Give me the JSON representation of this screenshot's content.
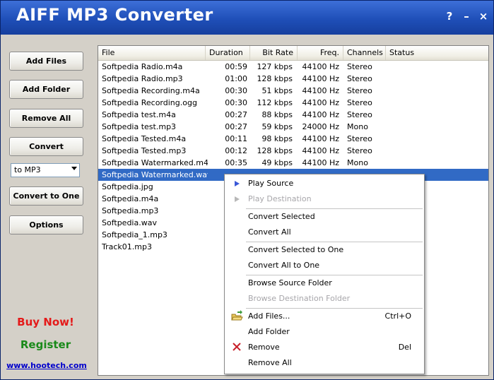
{
  "app": {
    "title": "AIFF MP3 Converter"
  },
  "titlebar": {
    "help_label": "?",
    "minimize_label": "–",
    "close_label": "×"
  },
  "sidebar": {
    "add_files": "Add Files",
    "add_folder": "Add Folder",
    "remove_all": "Remove All",
    "convert": "Convert",
    "format_selected": "to MP3",
    "convert_to_one": "Convert to One",
    "options": "Options",
    "buy_now": "Buy Now!",
    "register": "Register",
    "website": "www.hootech.com"
  },
  "colors": {
    "buy_now": "#e41a1a",
    "register": "#1a8a1a",
    "selection": "#316ac5",
    "titlebar": "#1f4fb8"
  },
  "table": {
    "columns": [
      "File",
      "Duration",
      "Bit Rate",
      "Freq.",
      "Channels",
      "Status"
    ],
    "rows": [
      [
        "Softpedia Radio.m4a",
        "00:59",
        "127 kbps",
        "44100 Hz",
        "Stereo"
      ],
      [
        "Softpedia Radio.mp3",
        "01:00",
        "128 kbps",
        "44100 Hz",
        "Stereo"
      ],
      [
        "Softpedia Recording.m4a",
        "00:30",
        "51 kbps",
        "44100 Hz",
        "Stereo"
      ],
      [
        "Softpedia Recording.ogg",
        "00:30",
        "112 kbps",
        "44100 Hz",
        "Stereo"
      ],
      [
        "Softpedia test.m4a",
        "00:27",
        "88 kbps",
        "44100 Hz",
        "Stereo"
      ],
      [
        "Softpedia test.mp3",
        "00:27",
        "59 kbps",
        "24000 Hz",
        "Mono"
      ],
      [
        "Softpedia Tested.m4a",
        "00:11",
        "98 kbps",
        "44100 Hz",
        "Stereo"
      ],
      [
        "Softpedia Tested.mp3",
        "00:12",
        "128 kbps",
        "44100 Hz",
        "Stereo"
      ],
      [
        "Softpedia Watermarked.m4a",
        "00:35",
        "49 kbps",
        "44100 Hz",
        "Mono"
      ],
      [
        "Softpedia Watermarked.wav",
        "",
        "",
        "",
        ""
      ],
      [
        "Softpedia.jpg",
        "",
        "",
        "",
        ""
      ],
      [
        "Softpedia.m4a",
        "",
        "",
        "",
        ""
      ],
      [
        "Softpedia.mp3",
        "",
        "",
        "",
        ""
      ],
      [
        "Softpedia.wav",
        "",
        "",
        "",
        ""
      ],
      [
        "Softpedia_1.mp3",
        "",
        "",
        "",
        ""
      ],
      [
        "Track01.mp3",
        "",
        "",
        "",
        ""
      ]
    ],
    "selected_index": 9
  },
  "context_menu": {
    "items": [
      {
        "label": "Play Source",
        "icon": "play-icon",
        "enabled": true
      },
      {
        "label": "Play Destination",
        "icon": "play-icon",
        "enabled": false
      },
      {
        "label": "Convert Selected",
        "enabled": true
      },
      {
        "label": "Convert All",
        "enabled": true
      },
      {
        "label": "Convert Selected to One",
        "enabled": true
      },
      {
        "label": "Convert All to One",
        "enabled": true
      },
      {
        "label": "Browse Source Folder",
        "enabled": true
      },
      {
        "label": "Browse Destination Folder",
        "enabled": false
      },
      {
        "label": "Add Files...",
        "icon": "open-folder-icon",
        "shortcut": "Ctrl+O",
        "enabled": true
      },
      {
        "label": "Add Folder",
        "enabled": true
      },
      {
        "label": "Remove",
        "icon": "remove-x-icon",
        "shortcut": "Del",
        "enabled": true
      },
      {
        "label": "Remove All",
        "enabled": true
      }
    ]
  }
}
